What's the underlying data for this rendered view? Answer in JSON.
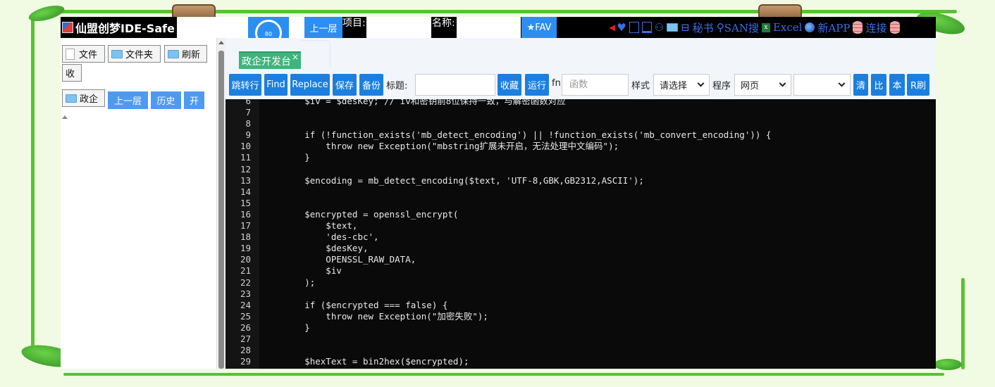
{
  "app": {
    "title": "仙盟创梦IDE-Safe",
    "gauge_value": "80",
    "up_label": "上一层",
    "project_label": "项目:",
    "name_label": "名称:",
    "fav_label": "★FAV",
    "menu": {
      "secretary": "秘书",
      "san_search": "SAN搜",
      "excel": "Excel",
      "new_app": "新APP",
      "connect": "连接"
    }
  },
  "sidebar": {
    "file_btn": "文件",
    "folder_btn": "文件夹",
    "refresh_btn": "刷新",
    "collapse_btn": "收",
    "root_folder": "政企",
    "up_btn": "上一层",
    "history_btn": "历史",
    "open_btn": "开"
  },
  "tab": {
    "label": "政企开发台",
    "close": "×"
  },
  "toolbar": {
    "goto_line": "跳转行",
    "find": "Find",
    "replace": "Replace",
    "save": "保存",
    "backup": "备份",
    "title_label": "标题:",
    "title_value": "",
    "collect": "收藏",
    "run": "运行",
    "fn_label": "fn",
    "fn_placeholder": "函数",
    "style_label": "样式",
    "style_value": "请选择",
    "program_label": "程序",
    "program_value": "网页",
    "extra_select_value": "",
    "clear": "清",
    "compare": "比",
    "local": "本",
    "r_refresh": "R刷"
  },
  "editor": {
    "lines": [
      {
        "n": "6",
        "t": "        $iv = $desKey; // iv和密钥前8位保持一致，与解密函数对应"
      },
      {
        "n": "7",
        "t": ""
      },
      {
        "n": "8",
        "t": ""
      },
      {
        "n": "9",
        "t": "        if (!function_exists('mb_detect_encoding') || !function_exists('mb_convert_encoding')) {"
      },
      {
        "n": "10",
        "t": "            throw new Exception(\"mbstring扩展未开启，无法处理中文编码\");"
      },
      {
        "n": "11",
        "t": "        }"
      },
      {
        "n": "12",
        "t": ""
      },
      {
        "n": "13",
        "t": "        $encoding = mb_detect_encoding($text, 'UTF-8,GBK,GB2312,ASCII');"
      },
      {
        "n": "14",
        "t": ""
      },
      {
        "n": "15",
        "t": ""
      },
      {
        "n": "16",
        "t": "        $encrypted = openssl_encrypt("
      },
      {
        "n": "17",
        "t": "            $text,"
      },
      {
        "n": "18",
        "t": "            'des-cbc',"
      },
      {
        "n": "19",
        "t": "            $desKey,"
      },
      {
        "n": "20",
        "t": "            OPENSSL_RAW_DATA,"
      },
      {
        "n": "21",
        "t": "            $iv"
      },
      {
        "n": "22",
        "t": "        );"
      },
      {
        "n": "23",
        "t": ""
      },
      {
        "n": "24",
        "t": "        if ($encrypted === false) {"
      },
      {
        "n": "25",
        "t": "            throw new Exception(\"加密失败\");"
      },
      {
        "n": "26",
        "t": "        }"
      },
      {
        "n": "27",
        "t": ""
      },
      {
        "n": "28",
        "t": ""
      },
      {
        "n": "29",
        "t": "        $hexText = bin2hex($encrypted);"
      }
    ]
  }
}
